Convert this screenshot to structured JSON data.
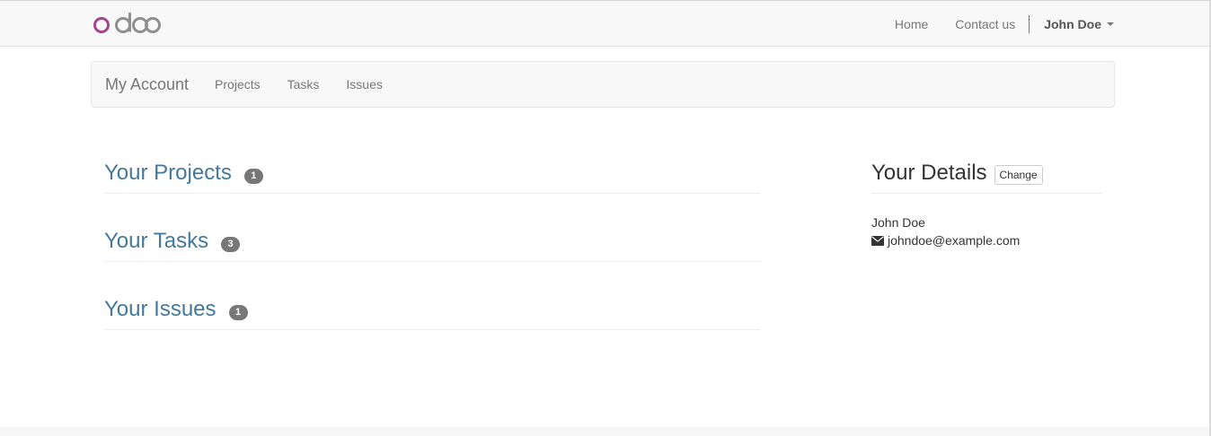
{
  "brand": {
    "logo_text": "odoo",
    "logo_color": "#a24689",
    "logo_grey": "#8f8f8f"
  },
  "topnav": {
    "home": "Home",
    "contact": "Contact us",
    "user": "John Doe"
  },
  "subnav": {
    "brand": "My Account",
    "links": [
      "Projects",
      "Tasks",
      "Issues"
    ]
  },
  "sections": [
    {
      "title": "Your Projects",
      "count": "1"
    },
    {
      "title": "Your Tasks",
      "count": "3"
    },
    {
      "title": "Your Issues",
      "count": "1"
    }
  ],
  "details": {
    "title": "Your Details",
    "change_label": "Change",
    "name": "John Doe",
    "email": "johndoe@example.com"
  },
  "colors": {
    "link_blue": "#44799c",
    "badge_grey": "#777777"
  }
}
